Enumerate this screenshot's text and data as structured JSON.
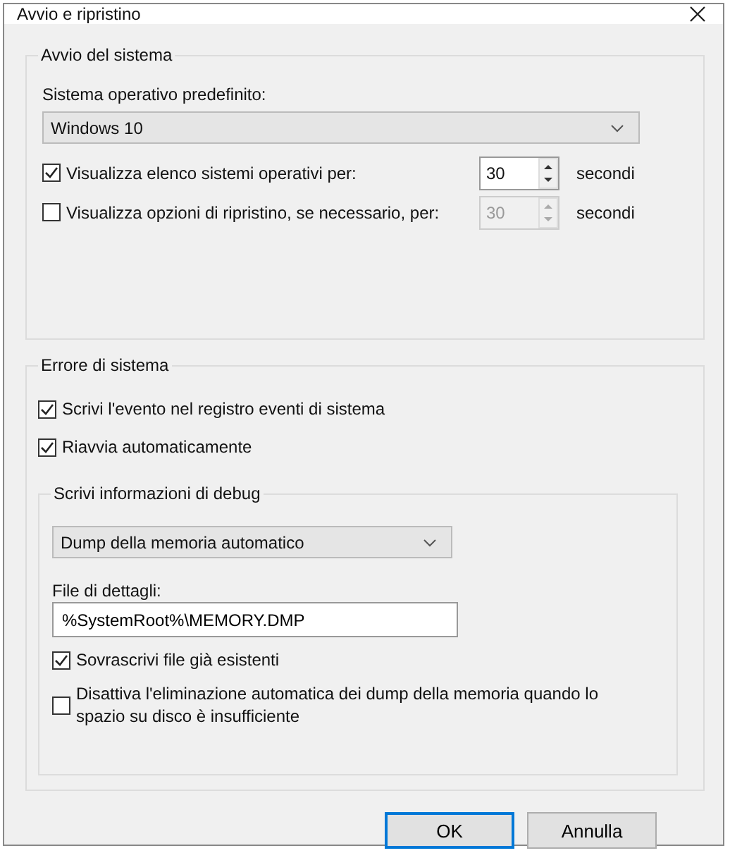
{
  "window": {
    "title": "Avvio e ripristino"
  },
  "startup": {
    "legend": "Avvio del sistema",
    "default_os_label": "Sistema operativo predefinito:",
    "default_os": "Windows 10",
    "options": [
      {
        "label": "Visualizza elenco sistemi operativi per:",
        "checked": true,
        "spinner": {
          "value": "30",
          "disabled": false
        },
        "unit": "secondi"
      },
      {
        "label": "Visualizza opzioni di ripristino, se necessario, per:",
        "checked": false,
        "spinner": {
          "value": "30",
          "disabled": true
        },
        "unit": "secondi"
      }
    ]
  },
  "system_failure": {
    "legend": "Errore di sistema",
    "options": [
      {
        "label": "Scrivi l'evento nel registro eventi di sistema",
        "checked": true
      },
      {
        "label": "Riavvia automaticamente",
        "checked": true
      }
    ],
    "debug": {
      "legend": "Scrivi informazioni di debug",
      "dump_type": "Dump della memoria automatico",
      "file_label": "File di dettagli:",
      "file": "%SystemRoot%\\MEMORY.DMP",
      "options": [
        {
          "label": "Sovrascrivi file già esistenti",
          "checked": true
        },
        {
          "label": "Disattiva l'eliminazione automatica dei dump della memoria quando lo spazio su disco è insufficiente",
          "checked": false
        }
      ]
    }
  },
  "buttons": [
    {
      "label": "OK",
      "default": true
    },
    {
      "label": "Annulla",
      "default": false
    }
  ]
}
